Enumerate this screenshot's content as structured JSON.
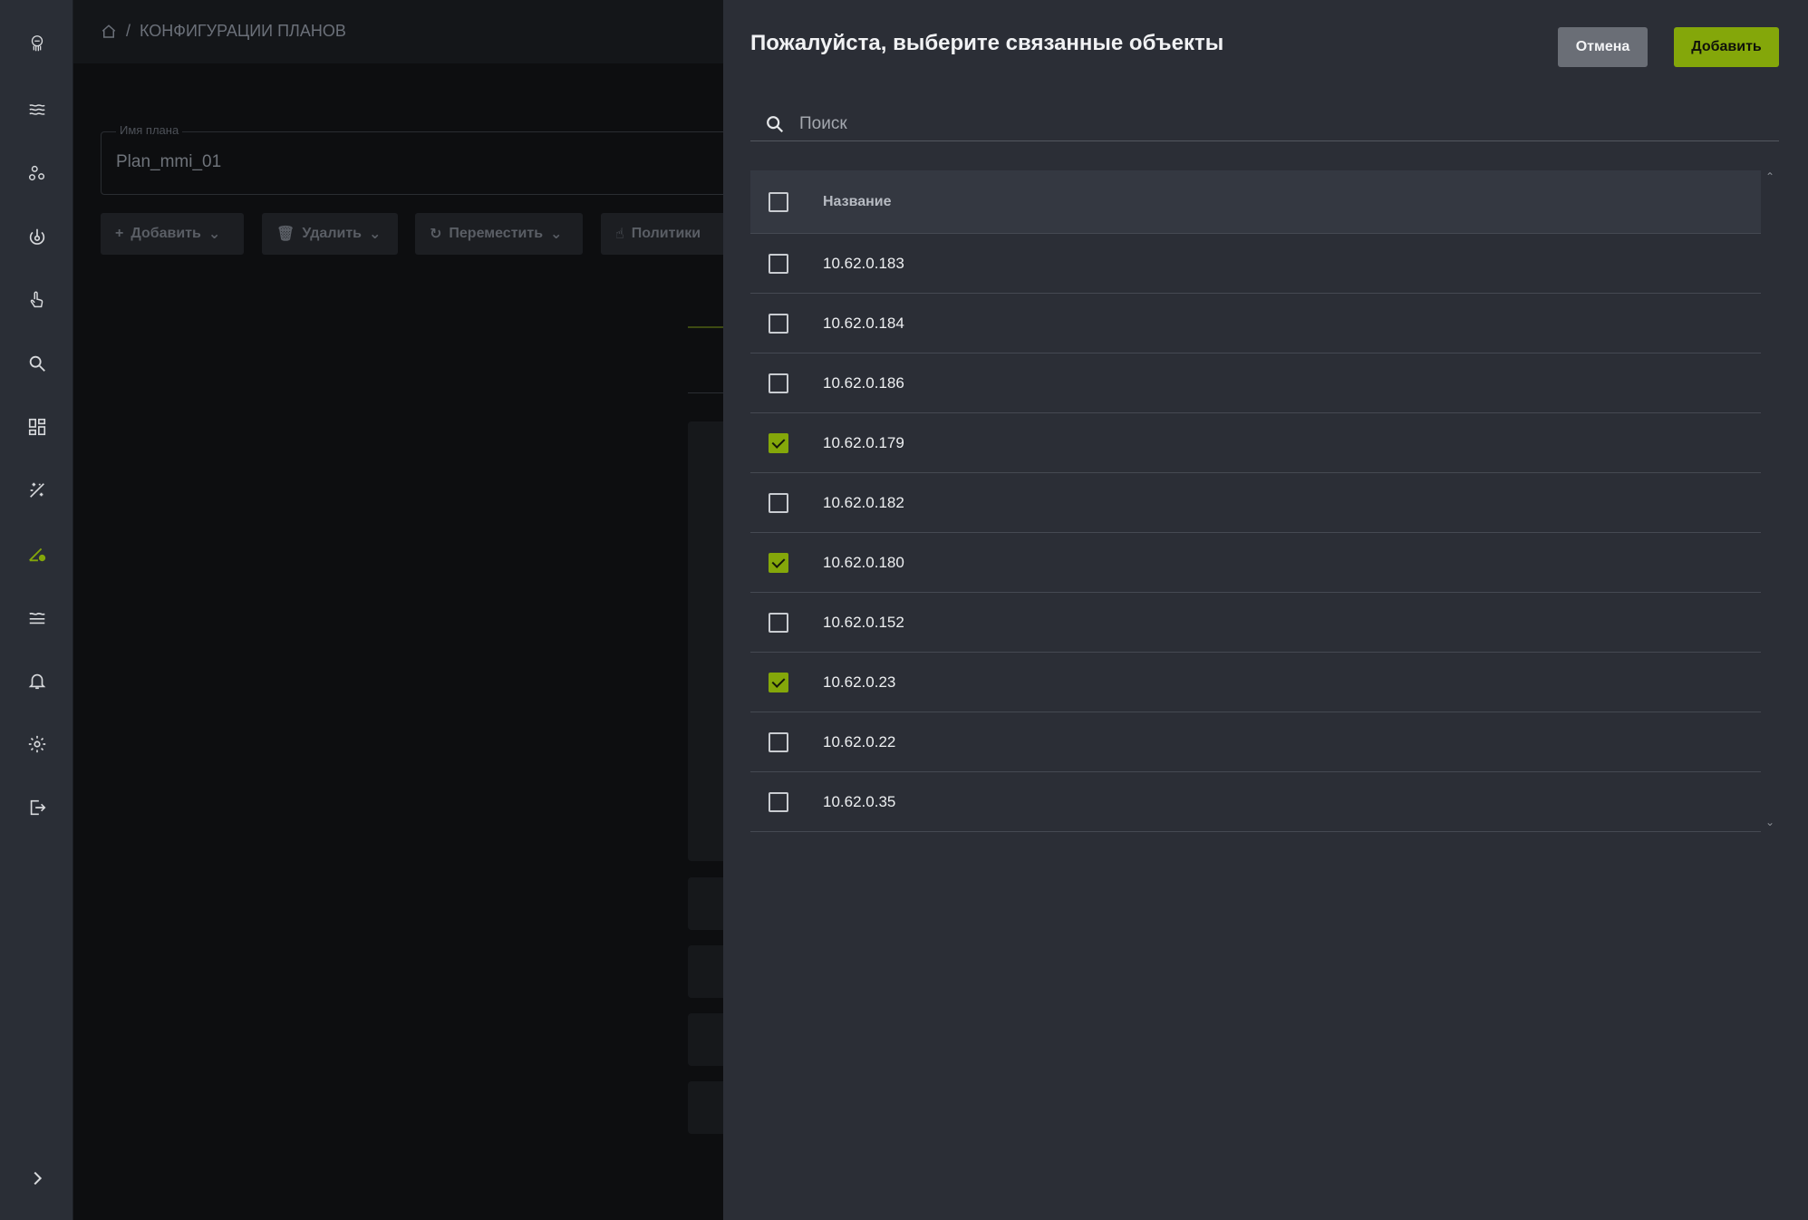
{
  "sidebar": {
    "icons": [
      "logo-icon",
      "waves-icon",
      "nodes-icon",
      "power-icon",
      "pointer-icon",
      "search-icon",
      "dashboard-icon",
      "magic-icon",
      "plan-config-icon",
      "layers-icon",
      "bell-icon",
      "gear-icon",
      "logout-icon",
      "expand-icon"
    ],
    "active": "plan-config-icon",
    "accent": "#84a70a"
  },
  "background": {
    "breadcrumb": "КОНФИГУРАЦИИ ПЛАНОВ",
    "plan_name_label": "Имя плана",
    "plan_name_value": "Plan_mmi_01",
    "toolbar": [
      "Добавить",
      "Удалить",
      "Переместить",
      "Политики"
    ]
  },
  "drawer": {
    "title": "Пожалуйста, выберите связанные объекты",
    "cancel_label": "Отмена",
    "add_label": "Добавить",
    "search_placeholder": "Поиск",
    "column_name": "Название",
    "rows": [
      {
        "name": "10.62.0.183",
        "checked": false
      },
      {
        "name": "10.62.0.184",
        "checked": false
      },
      {
        "name": "10.62.0.186",
        "checked": false
      },
      {
        "name": "10.62.0.179",
        "checked": true
      },
      {
        "name": "10.62.0.182",
        "checked": false
      },
      {
        "name": "10.62.0.180",
        "checked": true
      },
      {
        "name": "10.62.0.152",
        "checked": false
      },
      {
        "name": "10.62.0.23",
        "checked": true
      },
      {
        "name": "10.62.0.22",
        "checked": false
      },
      {
        "name": "10.62.0.35",
        "checked": false
      }
    ]
  }
}
